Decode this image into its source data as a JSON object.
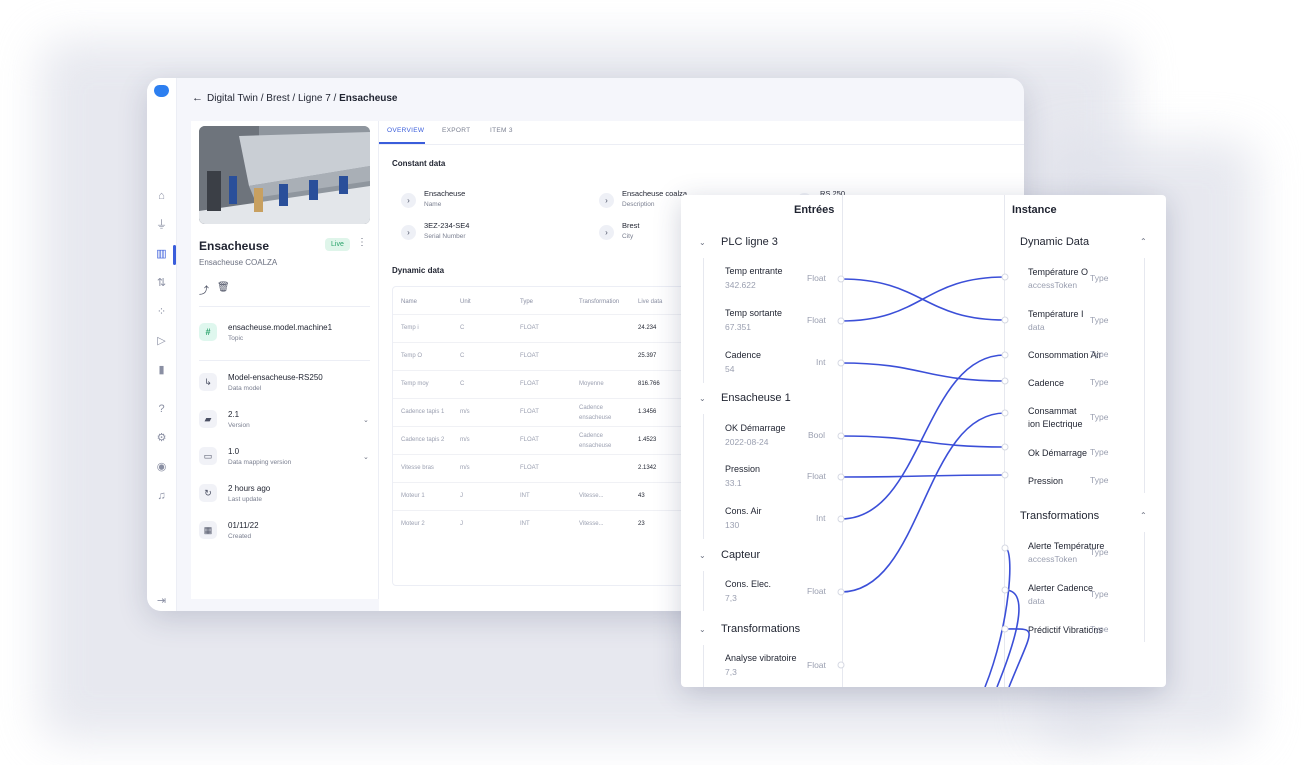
{
  "app": {
    "breadcrumb": {
      "p1": "Digital Twin /",
      "p2": "Brest / Ligne 7 /",
      "current": "Ensacheuse"
    },
    "asset": {
      "title": "Ensacheuse",
      "subtitle": "Ensacheuse COALZA",
      "status": "Live",
      "rows": [
        {
          "value": "ensacheuse.model.machine1",
          "label": "Topic"
        },
        {
          "value": "Model-ensacheuse-RS250",
          "label": "Data model"
        },
        {
          "value": "2.1",
          "label": "Version"
        },
        {
          "value": "1.0",
          "label": "Data mapping version"
        },
        {
          "value": "2 hours ago",
          "label": "Last update"
        },
        {
          "value": "01/11/22",
          "label": "Created"
        }
      ]
    },
    "tabs": [
      "OVERVIEW",
      "EXPORT",
      "ITEM 3"
    ],
    "constant": {
      "title": "Constant data",
      "items": [
        {
          "value": "Ensacheuse",
          "label": "Name"
        },
        {
          "value": "Ensacheuse coalza",
          "label": "Description"
        },
        {
          "value": "RS 250",
          "label": ""
        },
        {
          "value": "3EZ-234-SE4",
          "label": "Serial Number"
        },
        {
          "value": "Brest",
          "label": "City"
        }
      ]
    },
    "dynamic": {
      "title": "Dynamic data",
      "headers": [
        "Name",
        "Unit",
        "Type",
        "Transformation",
        "Live data"
      ],
      "rows": [
        [
          "Temp i",
          "C",
          "FLOAT",
          "",
          "24.234"
        ],
        [
          "Temp O",
          "C",
          "FLOAT",
          "",
          "25.397"
        ],
        [
          "Temp moy",
          "C",
          "FLOAT",
          "Moyenne",
          "816.766"
        ],
        [
          "Cadence tapis 1",
          "m/s",
          "FLOAT",
          "Cadence ensacheuse",
          "1.3456"
        ],
        [
          "Cadence tapis 2",
          "m/s",
          "FLOAT",
          "Cadence ensacheuse",
          "1.4523"
        ],
        [
          "Vitesse bras",
          "m/s",
          "FLOAT",
          "",
          "2.1342"
        ],
        [
          "Moteur 1",
          "J",
          "INT",
          "Vitesse...",
          "43"
        ],
        [
          "Moteur 2",
          "J",
          "INT",
          "Vitesse...",
          "23"
        ]
      ]
    }
  },
  "mapper": {
    "left_title": "Entrées",
    "right_title": "Instance",
    "inputs": [
      {
        "group": "PLC ligne 3",
        "fields": [
          {
            "name": "Temp entrante",
            "value": "342.622",
            "type": "Float"
          },
          {
            "name": "Temp sortante",
            "value": "67.351",
            "type": "Float"
          },
          {
            "name": "Cadence",
            "value": "54",
            "type": "Int"
          }
        ]
      },
      {
        "group": "Ensacheuse 1",
        "fields": [
          {
            "name": "OK Démarrage",
            "value": "2022-08-24",
            "type": "Bool"
          },
          {
            "name": "Pression",
            "value": "33.1",
            "type": "Float"
          },
          {
            "name": "Cons. Air",
            "value": "130",
            "type": "Int"
          }
        ]
      },
      {
        "group": "Capteur",
        "fields": [
          {
            "name": "Cons. Elec.",
            "value": "7,3",
            "type": "Float"
          }
        ]
      },
      {
        "group": "Transformations",
        "fields": [
          {
            "name": "Analyse vibratoire",
            "value": "7,3",
            "type": "Float"
          }
        ]
      }
    ],
    "instance": [
      {
        "group": "Dynamic Data",
        "fields": [
          {
            "name": "Température O",
            "value": "accessToken",
            "type": "Type"
          },
          {
            "name": "Température I",
            "value": "data",
            "type": "Type"
          },
          {
            "name": "Consommation Air",
            "value": "",
            "type": "Type"
          },
          {
            "name": "Cadence",
            "value": "",
            "type": "Type"
          },
          {
            "name": "Consammat ion Electrique",
            "value": "",
            "type": "Type"
          },
          {
            "name": "Ok Démarrage",
            "value": "",
            "type": "Type"
          },
          {
            "name": "Pression",
            "value": "",
            "type": "Type"
          }
        ]
      },
      {
        "group": "Transformations",
        "fields": [
          {
            "name": "Alerte Température",
            "value": "accessToken",
            "type": "Type"
          },
          {
            "name": "Alerter Cadence",
            "value": "data",
            "type": "Type"
          },
          {
            "name": "Prédictif Vibrations",
            "value": "",
            "type": "Type"
          }
        ]
      }
    ],
    "wire_color": "#3b4fd8"
  }
}
